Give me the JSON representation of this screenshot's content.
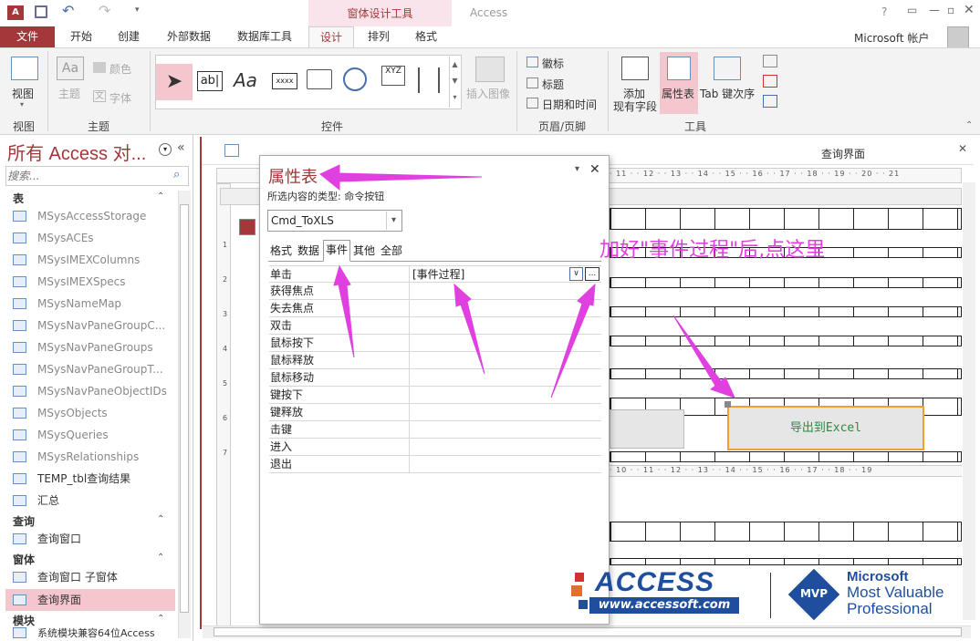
{
  "window": {
    "context_tab": "窗体设计工具",
    "app_title": "Access",
    "help": "?",
    "account": "Microsoft 帐户"
  },
  "tabs": [
    "文件",
    "开始",
    "创建",
    "外部数据",
    "数据库工具",
    "设计",
    "排列",
    "格式"
  ],
  "ribbon": {
    "view": "视图",
    "theme": "主题",
    "colors": "颜色",
    "fonts": "字体",
    "insert_image": "插入图像",
    "logo": "徽标",
    "title": "标题",
    "date_time": "日期和时间",
    "add_fields": "添加",
    "add_fields2": "现有字段",
    "property_sheet": "属性表",
    "tab_order": "Tab 键次序",
    "groups": {
      "views": "视图",
      "themes": "主题",
      "controls": "控件",
      "header_footer": "页眉/页脚",
      "tools": "工具"
    }
  },
  "nav": {
    "title": "所有 Access 对...",
    "search_placeholder": "搜索...",
    "sections": {
      "tables": "表",
      "queries": "查询",
      "forms": "窗体",
      "modules": "模块"
    },
    "tables": [
      "MSysAccessStorage",
      "MSysACEs",
      "MSysIMEXColumns",
      "MSysIMEXSpecs",
      "MSysNameMap",
      "MSysNavPaneGroupC...",
      "MSysNavPaneGroups",
      "MSysNavPaneGroupT...",
      "MSysNavPaneObjectIDs",
      "MSysObjects",
      "MSysQueries",
      "MSysRelationships",
      "TEMP_tbl查询结果",
      "汇总"
    ],
    "queries": [
      "查询窗口"
    ],
    "forms": [
      "查询窗口 子窗体",
      "查询界面"
    ],
    "modules": [
      "系统模块兼容64位Access"
    ]
  },
  "surface": {
    "tab_title": "查询界面",
    "export_button": "导出到Excel",
    "ruler_top": "· 11 · · 12 · · 13 · · 14 · · 15 · · 16 · · 17 · · 18 · · 19 · · 20 · · 21",
    "ruler_mid": "· 10 · · 11 · · 12 · · 13 · · 14 · · 15 · · 16 · · 17 · · 18 · · 19",
    "v_ruler": [
      "1",
      "2",
      "3",
      "4",
      "5",
      "6",
      "7"
    ]
  },
  "property_sheet": {
    "title": "属性表",
    "selection_type": "所选内容的类型: 命令按钮",
    "control_name": "Cmd_ToXLS",
    "tabs": [
      "格式",
      "数据",
      "事件",
      "其他",
      "全部"
    ],
    "active_tab": "事件",
    "rows": [
      {
        "k": "单击",
        "v": "[事件过程]"
      },
      {
        "k": "获得焦点",
        "v": ""
      },
      {
        "k": "失去焦点",
        "v": ""
      },
      {
        "k": "双击",
        "v": ""
      },
      {
        "k": "鼠标按下",
        "v": ""
      },
      {
        "k": "鼠标释放",
        "v": ""
      },
      {
        "k": "鼠标移动",
        "v": ""
      },
      {
        "k": "键按下",
        "v": ""
      },
      {
        "k": "键释放",
        "v": ""
      },
      {
        "k": "击键",
        "v": ""
      },
      {
        "k": "进入",
        "v": ""
      },
      {
        "k": "退出",
        "v": ""
      }
    ],
    "builder_button": "..."
  },
  "annotation": "加好\"事件过程\"后,点这里",
  "watermark": {
    "access": "ACCESS",
    "url": "www.accessoft.com",
    "ms": "Microsoft",
    "mvp": "MVP",
    "mvp_line1": "Most Valuable",
    "mvp_line2": "Professional"
  },
  "colors": {
    "brand": "#a4373a",
    "annotation": "#e040e0",
    "selected_button_border": "#f0a030"
  }
}
